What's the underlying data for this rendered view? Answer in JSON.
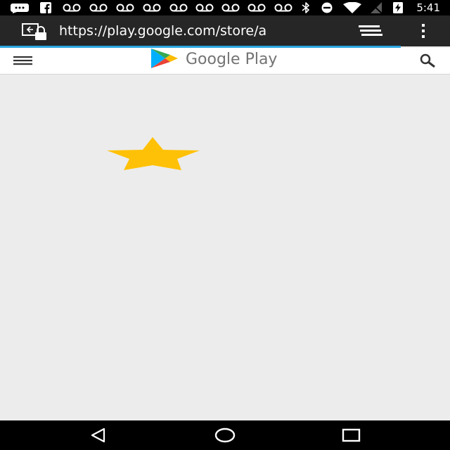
{
  "status_bar": {
    "time": "5:41",
    "icons": [
      "message-icon",
      "facebook-icon",
      "voicemail-icon",
      "bluetooth-icon",
      "do-not-disturb-icon",
      "wifi-icon",
      "no-signal-icon",
      "battery-charging-icon"
    ]
  },
  "browser": {
    "url": "https://play.google.com/store/a",
    "progress": 0.89,
    "accent_color": "#2aa6e0"
  },
  "app_header": {
    "brand": "Google Play"
  },
  "content": {
    "star_color": "#ffc107"
  },
  "nav_bar": {
    "buttons": [
      "back",
      "home",
      "recents"
    ]
  }
}
